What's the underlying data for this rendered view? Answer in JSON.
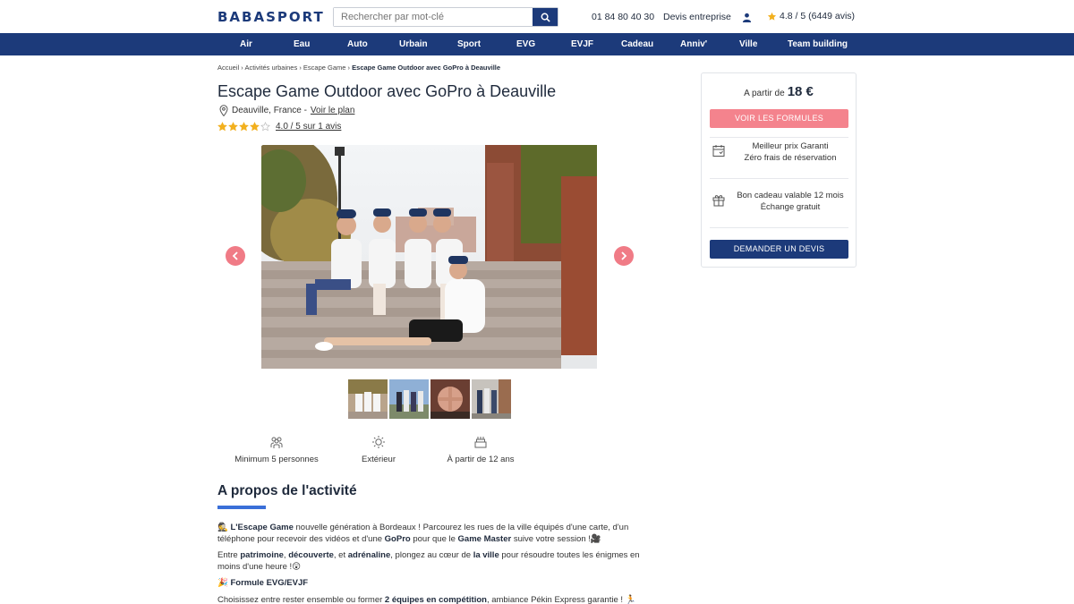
{
  "header": {
    "logo": "BABASPORT",
    "search_placeholder": "Rechercher par mot-clé",
    "phone": "01 84 80 40 30",
    "devis": "Devis entreprise",
    "rating": "4.8 / 5 (6449 avis)"
  },
  "nav": [
    "Air",
    "Eau",
    "Auto",
    "Urbain",
    "Sport",
    "EVG",
    "EVJF",
    "Cadeau",
    "Anniv'",
    "Ville",
    "Team building"
  ],
  "breadcrumb": {
    "items": [
      "Accueil",
      "Activités urbaines",
      "Escape Game"
    ],
    "current": "Escape Game Outdoor avec GoPro à Deauville",
    "separator": "›"
  },
  "activity": {
    "title": "Escape Game Outdoor avec GoPro à Deauville",
    "location": "Deauville, France -",
    "map_link": "Voir le plan",
    "stars": 4,
    "rating_text": "4.0 / 5 sur 1 avis"
  },
  "features": [
    {
      "label": "Minimum 5 personnes",
      "icon": "group-icon"
    },
    {
      "label": "Extérieur",
      "icon": "sun-icon"
    },
    {
      "label": "À partir de 12 ans",
      "icon": "cake-icon"
    }
  ],
  "about": {
    "heading": "A propos de l'activité",
    "p1": [
      {
        "t": "🕵️ ",
        "b": false
      },
      {
        "t": "L'Escape Game",
        "b": true
      },
      {
        "t": " nouvelle génération à Bordeaux ! Parcourez les rues de la ville équipés d'une carte, d'un téléphone pour recevoir des vidéos et d'une ",
        "b": false
      },
      {
        "t": "GoPro",
        "b": true
      },
      {
        "t": " pour que le ",
        "b": false
      },
      {
        "t": "Game Master",
        "b": true
      },
      {
        "t": " suive votre session !🎥",
        "b": false
      }
    ],
    "p2": [
      {
        "t": "Entre ",
        "b": false
      },
      {
        "t": "patrimoine",
        "b": true
      },
      {
        "t": ", ",
        "b": false
      },
      {
        "t": "découverte",
        "b": true
      },
      {
        "t": ", et ",
        "b": false
      },
      {
        "t": "adrénaline",
        "b": true
      },
      {
        "t": ", plongez au cœur de ",
        "b": false
      },
      {
        "t": "la ville",
        "b": true
      },
      {
        "t": " pour résoudre toutes les énigmes en moins d'une heure !😲",
        "b": false
      }
    ],
    "p3": [
      {
        "t": "🎉 ",
        "b": false
      },
      {
        "t": "Formule EVG/EVJF",
        "b": true
      }
    ],
    "p4": [
      {
        "t": "Choisissez entre rester ensemble ou former ",
        "b": false
      },
      {
        "t": "2 équipes en compétition",
        "b": true
      },
      {
        "t": ", ambiance Pékin Express garantie ! 🏃",
        "b": false
      }
    ]
  },
  "card": {
    "from": "A partir de",
    "price": "18 €",
    "cta_primary": "VOIR LES FORMULES",
    "perk1_line1": "Meilleur prix Garanti",
    "perk1_line2": "Zéro frais de réservation",
    "perk2_line1": "Bon cadeau valable 12 mois",
    "perk2_line2": "Échange gratuit",
    "cta_secondary": "DEMANDER UN DEVIS"
  },
  "colors": {
    "brand": "#1c3a7a",
    "accent_pink": "#f4838d",
    "accent_blue": "#3a6fd8"
  }
}
